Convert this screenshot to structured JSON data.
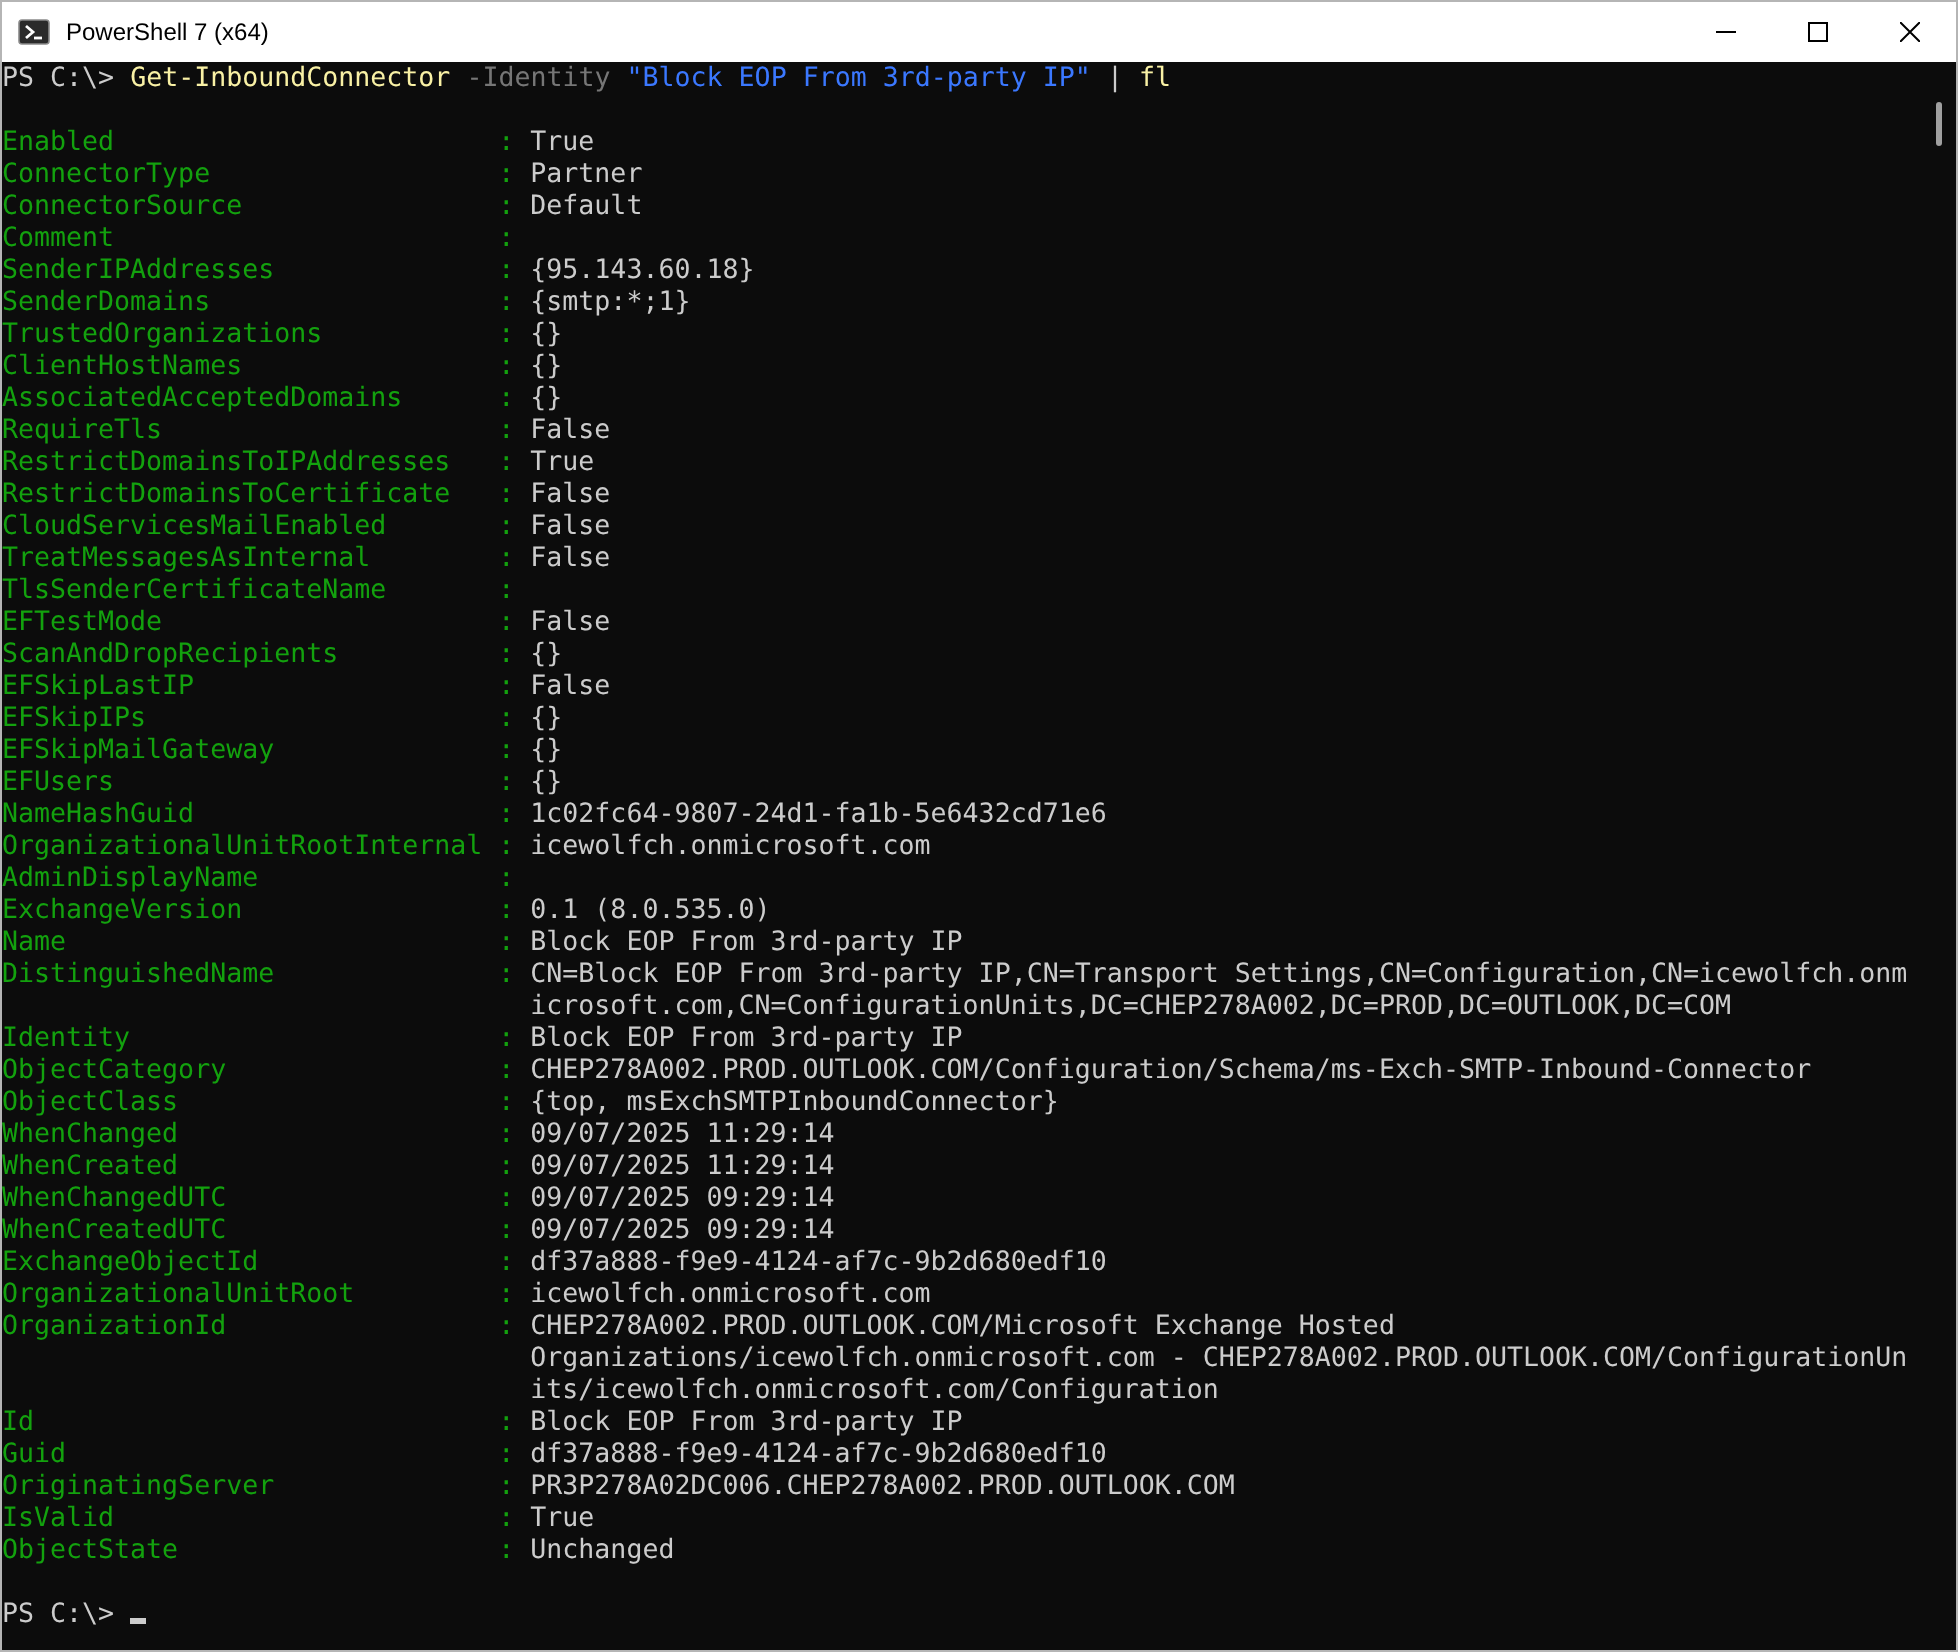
{
  "window": {
    "title": "PowerShell 7 (x64)"
  },
  "command": {
    "prompt": "PS C:\\>",
    "tokens": [
      {
        "kind": "command",
        "text": "Get-InboundConnector"
      },
      {
        "kind": "parameter",
        "text": "-Identity"
      },
      {
        "kind": "string",
        "text": "\"Block EOP From 3rd-party IP\""
      },
      {
        "kind": "operator",
        "text": "|"
      },
      {
        "kind": "command",
        "text": "fl"
      }
    ]
  },
  "properties": [
    {
      "name": "Enabled",
      "separator": ":",
      "value_lines": [
        "True"
      ]
    },
    {
      "name": "ConnectorType",
      "separator": ":",
      "value_lines": [
        "Partner"
      ]
    },
    {
      "name": "ConnectorSource",
      "separator": ":",
      "value_lines": [
        "Default"
      ]
    },
    {
      "name": "Comment",
      "separator": ":"
    },
    {
      "name": "SenderIPAddresses",
      "separator": ":",
      "value_lines": [
        "{95.143.60.18}"
      ]
    },
    {
      "name": "SenderDomains",
      "separator": ":",
      "value_lines": [
        "{smtp:*;1}"
      ]
    },
    {
      "name": "TrustedOrganizations",
      "separator": ":",
      "value_lines": [
        "{}"
      ]
    },
    {
      "name": "ClientHostNames",
      "separator": ":",
      "value_lines": [
        "{}"
      ]
    },
    {
      "name": "AssociatedAcceptedDomains",
      "separator": ":",
      "value_lines": [
        "{}"
      ]
    },
    {
      "name": "RequireTls",
      "separator": ":",
      "value_lines": [
        "False"
      ]
    },
    {
      "name": "RestrictDomainsToIPAddresses",
      "separator": ":",
      "value_lines": [
        "True"
      ]
    },
    {
      "name": "RestrictDomainsToCertificate",
      "separator": ":",
      "value_lines": [
        "False"
      ]
    },
    {
      "name": "CloudServicesMailEnabled",
      "separator": ":",
      "value_lines": [
        "False"
      ]
    },
    {
      "name": "TreatMessagesAsInternal",
      "separator": ":",
      "value_lines": [
        "False"
      ]
    },
    {
      "name": "TlsSenderCertificateName",
      "separator": ":"
    },
    {
      "name": "EFTestMode",
      "separator": ":",
      "value_lines": [
        "False"
      ]
    },
    {
      "name": "ScanAndDropRecipients",
      "separator": ":",
      "value_lines": [
        "{}"
      ]
    },
    {
      "name": "EFSkipLastIP",
      "separator": ":",
      "value_lines": [
        "False"
      ]
    },
    {
      "name": "EFSkipIPs",
      "separator": ":",
      "value_lines": [
        "{}"
      ]
    },
    {
      "name": "EFSkipMailGateway",
      "separator": ":",
      "value_lines": [
        "{}"
      ]
    },
    {
      "name": "EFUsers",
      "separator": ":",
      "value_lines": [
        "{}"
      ]
    },
    {
      "name": "NameHashGuid",
      "separator": ":",
      "value_lines": [
        "1c02fc64-9807-24d1-fa1b-5e6432cd71e6"
      ]
    },
    {
      "name": "OrganizationalUnitRootInternal",
      "separator": ":",
      "value_lines": [
        "icewolfch.onmicrosoft.com"
      ]
    },
    {
      "name": "AdminDisplayName",
      "separator": ":"
    },
    {
      "name": "ExchangeVersion",
      "separator": ":",
      "value_lines": [
        "0.1 (8.0.535.0)"
      ]
    },
    {
      "name": "Name",
      "separator": ":",
      "value_lines": [
        "Block EOP From 3rd-party IP"
      ]
    },
    {
      "name": "DistinguishedName",
      "separator": ":",
      "value_lines": [
        "CN=Block EOP From 3rd-party IP,CN=Transport Settings,CN=Configuration,CN=icewolfch.onm",
        "icrosoft.com,CN=ConfigurationUnits,DC=CHEP278A002,DC=PROD,DC=OUTLOOK,DC=COM"
      ]
    },
    {
      "name": "Identity",
      "separator": ":",
      "value_lines": [
        "Block EOP From 3rd-party IP"
      ]
    },
    {
      "name": "ObjectCategory",
      "separator": ":",
      "value_lines": [
        "CHEP278A002.PROD.OUTLOOK.COM/Configuration/Schema/ms-Exch-SMTP-Inbound-Connector"
      ]
    },
    {
      "name": "ObjectClass",
      "separator": ":",
      "value_lines": [
        "{top, msExchSMTPInboundConnector}"
      ]
    },
    {
      "name": "WhenChanged",
      "separator": ":",
      "value_lines": [
        "09/07/2025 11:29:14"
      ]
    },
    {
      "name": "WhenCreated",
      "separator": ":",
      "value_lines": [
        "09/07/2025 11:29:14"
      ]
    },
    {
      "name": "WhenChangedUTC",
      "separator": ":",
      "value_lines": [
        "09/07/2025 09:29:14"
      ]
    },
    {
      "name": "WhenCreatedUTC",
      "separator": ":",
      "value_lines": [
        "09/07/2025 09:29:14"
      ]
    },
    {
      "name": "ExchangeObjectId",
      "separator": ":",
      "value_lines": [
        "df37a888-f9e9-4124-af7c-9b2d680edf10"
      ]
    },
    {
      "name": "OrganizationalUnitRoot",
      "separator": ":",
      "value_lines": [
        "icewolfch.onmicrosoft.com"
      ]
    },
    {
      "name": "OrganizationId",
      "separator": ":",
      "value_lines": [
        "CHEP278A002.PROD.OUTLOOK.COM/Microsoft Exchange Hosted",
        "Organizations/icewolfch.onmicrosoft.com - CHEP278A002.PROD.OUTLOOK.COM/ConfigurationUn",
        "its/icewolfch.onmicrosoft.com/Configuration"
      ]
    },
    {
      "name": "Id",
      "separator": ":",
      "value_lines": [
        "Block EOP From 3rd-party IP"
      ]
    },
    {
      "name": "Guid",
      "separator": ":",
      "value_lines": [
        "df37a888-f9e9-4124-af7c-9b2d680edf10"
      ]
    },
    {
      "name": "OriginatingServer",
      "separator": ":",
      "value_lines": [
        "PR3P278A02DC006.CHEP278A002.PROD.OUTLOOK.COM"
      ]
    },
    {
      "name": "IsValid",
      "separator": ":",
      "value_lines": [
        "True"
      ]
    },
    {
      "name": "ObjectState",
      "separator": ":",
      "value_lines": [
        "Unchanged"
      ]
    }
  ],
  "prompt": {
    "text": "PS C:\\>"
  }
}
